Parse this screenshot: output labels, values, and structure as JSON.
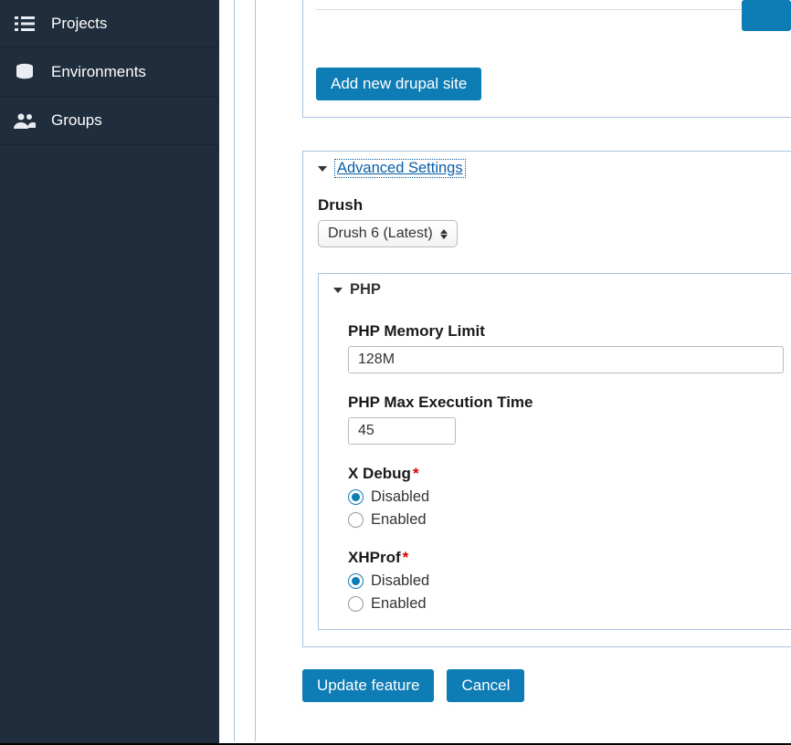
{
  "sidebar": {
    "items": [
      {
        "label": "Projects"
      },
      {
        "label": "Environments"
      },
      {
        "label": "Groups"
      }
    ]
  },
  "sites_box": {
    "add_button": "Add new drupal site"
  },
  "advanced_settings": {
    "legend": "Advanced Settings",
    "drush": {
      "label": "Drush",
      "selected": "Drush 6 (Latest)"
    }
  },
  "php": {
    "legend": "PHP",
    "memory_limit": {
      "label": "PHP Memory Limit",
      "value": "128M"
    },
    "max_exec": {
      "label": "PHP Max Execution Time",
      "value": "45"
    },
    "xdebug": {
      "label": "X Debug",
      "required": "*",
      "options": {
        "disabled": "Disabled",
        "enabled": "Enabled"
      },
      "value": "disabled"
    },
    "xhprof": {
      "label": "XHProf",
      "required": "*",
      "options": {
        "disabled": "Disabled",
        "enabled": "Enabled"
      },
      "value": "disabled"
    }
  },
  "footer": {
    "update": "Update feature",
    "cancel": "Cancel"
  }
}
